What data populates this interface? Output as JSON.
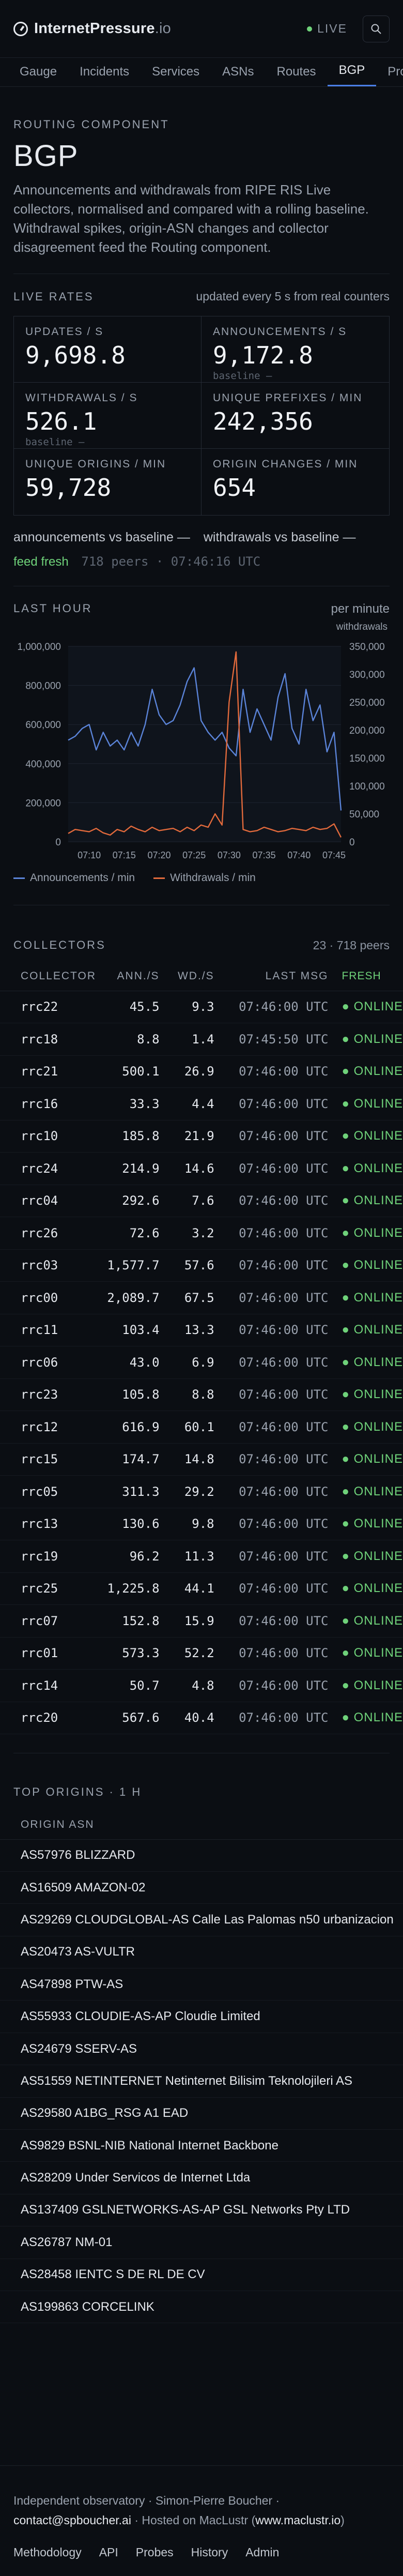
{
  "brand": {
    "name": "InternetPressure",
    "suffix": ".io"
  },
  "live": {
    "label": "LIVE"
  },
  "nav": {
    "tabs": [
      "Gauge",
      "Incidents",
      "Services",
      "ASNs",
      "Routes",
      "BGP",
      "Pro"
    ],
    "active": "BGP"
  },
  "hero": {
    "eyebrow": "ROUTING COMPONENT",
    "title": "BGP",
    "description": "Announcements and withdrawals from RIPE RIS Live collectors, normalised and compared with a rolling baseline. Withdrawal spikes, origin-ASN changes and collector disagreement feed the Routing component."
  },
  "rates": {
    "eyebrow": "LIVE RATES",
    "note": "updated every 5 s from real counters",
    "cells": [
      {
        "label": "UPDATES / S",
        "value": "9,698.8",
        "baseline": ""
      },
      {
        "label": "ANNOUNCEMENTS / S",
        "value": "9,172.8",
        "baseline": "baseline —"
      },
      {
        "label": "WITHDRAWALS / S",
        "value": "526.1",
        "baseline": "baseline —"
      },
      {
        "label": "UNIQUE PREFIXES / MIN",
        "value": "242,356",
        "baseline": ""
      },
      {
        "label": "UNIQUE ORIGINS / MIN",
        "value": "59,728",
        "baseline": ""
      },
      {
        "label": "ORIGIN CHANGES / MIN",
        "value": "654",
        "baseline": ""
      }
    ],
    "vs_announcements": "announcements vs baseline —",
    "vs_withdrawals": "withdrawals vs baseline —",
    "feed_status": "feed fresh",
    "feed_meta": "718 peers · 07:46:16 UTC"
  },
  "last_hour": {
    "eyebrow": "LAST HOUR",
    "unit": "per minute",
    "right_axis_label": "withdrawals",
    "legend_announcements": "Announcements / min",
    "legend_withdrawals": "Withdrawals / min"
  },
  "chart_data": {
    "type": "line",
    "x": [
      "07:07",
      "07:08",
      "07:09",
      "07:10",
      "07:11",
      "07:12",
      "07:13",
      "07:14",
      "07:15",
      "07:16",
      "07:17",
      "07:18",
      "07:19",
      "07:20",
      "07:21",
      "07:22",
      "07:23",
      "07:24",
      "07:25",
      "07:26",
      "07:27",
      "07:28",
      "07:29",
      "07:30",
      "07:31",
      "07:32",
      "07:33",
      "07:34",
      "07:35",
      "07:36",
      "07:37",
      "07:38",
      "07:39",
      "07:40",
      "07:41",
      "07:42",
      "07:43",
      "07:44",
      "07:45",
      "07:46"
    ],
    "xticks": [
      "07:10",
      "07:15",
      "07:20",
      "07:25",
      "07:30",
      "07:35",
      "07:40",
      "07:45"
    ],
    "left_ticks": [
      "1,000,000",
      "800,000",
      "600,000",
      "400,000",
      "200,000",
      "0"
    ],
    "right_ticks": [
      "350,000",
      "300,000",
      "250,000",
      "200,000",
      "150,000",
      "100,000",
      "50,000",
      "0"
    ],
    "ylim": [
      0,
      1000000
    ],
    "y2lim": [
      0,
      350000
    ],
    "series": [
      {
        "name": "Announcements / min",
        "axis": "left",
        "color": "#5b84d9",
        "values": [
          520000,
          540000,
          580000,
          600000,
          470000,
          560000,
          490000,
          520000,
          470000,
          560000,
          490000,
          600000,
          780000,
          650000,
          600000,
          620000,
          700000,
          820000,
          890000,
          620000,
          560000,
          520000,
          560000,
          480000,
          440000,
          780000,
          560000,
          680000,
          600000,
          520000,
          740000,
          860000,
          580000,
          500000,
          780000,
          620000,
          700000,
          460000,
          560000,
          160000
        ]
      },
      {
        "name": "Withdrawals / min",
        "axis": "right",
        "color": "#e26a3c",
        "values": [
          15000,
          22000,
          20000,
          18000,
          24000,
          16000,
          12000,
          22000,
          18000,
          28000,
          22000,
          18000,
          26000,
          20000,
          22000,
          24000,
          18000,
          26000,
          20000,
          30000,
          26000,
          50000,
          30000,
          250000,
          340000,
          22000,
          18000,
          20000,
          26000,
          22000,
          18000,
          20000,
          24000,
          22000,
          20000,
          26000,
          22000,
          24000,
          32000,
          8000
        ]
      }
    ]
  },
  "collectors": {
    "eyebrow": "COLLECTORS",
    "meta": "23 · 718 peers",
    "columns": [
      "COLLECTOR",
      "ANN./S",
      "WD./S",
      "LAST MSG",
      "FRESH"
    ],
    "rows": [
      [
        "rrc22",
        "45.5",
        "9.3",
        "07:46:00 UTC",
        "● ONLINE"
      ],
      [
        "rrc18",
        "8.8",
        "1.4",
        "07:45:50 UTC",
        "● ONLINE"
      ],
      [
        "rrc21",
        "500.1",
        "26.9",
        "07:46:00 UTC",
        "● ONLINE"
      ],
      [
        "rrc16",
        "33.3",
        "4.4",
        "07:46:00 UTC",
        "● ONLINE"
      ],
      [
        "rrc10",
        "185.8",
        "21.9",
        "07:46:00 UTC",
        "● ONLINE"
      ],
      [
        "rrc24",
        "214.9",
        "14.6",
        "07:46:00 UTC",
        "● ONLINE"
      ],
      [
        "rrc04",
        "292.6",
        "7.6",
        "07:46:00 UTC",
        "● ONLINE"
      ],
      [
        "rrc26",
        "72.6",
        "3.2",
        "07:46:00 UTC",
        "● ONLINE"
      ],
      [
        "rrc03",
        "1,577.7",
        "57.6",
        "07:46:00 UTC",
        "● ONLINE"
      ],
      [
        "rrc00",
        "2,089.7",
        "67.5",
        "07:46:00 UTC",
        "● ONLINE"
      ],
      [
        "rrc11",
        "103.4",
        "13.3",
        "07:46:00 UTC",
        "● ONLINE"
      ],
      [
        "rrc06",
        "43.0",
        "6.9",
        "07:46:00 UTC",
        "● ONLINE"
      ],
      [
        "rrc23",
        "105.8",
        "8.8",
        "07:46:00 UTC",
        "● ONLINE"
      ],
      [
        "rrc12",
        "616.9",
        "60.1",
        "07:46:00 UTC",
        "● ONLINE"
      ],
      [
        "rrc15",
        "174.7",
        "14.8",
        "07:46:00 UTC",
        "● ONLINE"
      ],
      [
        "rrc05",
        "311.3",
        "29.2",
        "07:46:00 UTC",
        "● ONLINE"
      ],
      [
        "rrc13",
        "130.6",
        "9.8",
        "07:46:00 UTC",
        "● ONLINE"
      ],
      [
        "rrc19",
        "96.2",
        "11.3",
        "07:46:00 UTC",
        "● ONLINE"
      ],
      [
        "rrc25",
        "1,225.8",
        "44.1",
        "07:46:00 UTC",
        "● ONLINE"
      ],
      [
        "rrc07",
        "152.8",
        "15.9",
        "07:46:00 UTC",
        "● ONLINE"
      ],
      [
        "rrc01",
        "573.3",
        "52.2",
        "07:46:00 UTC",
        "● ONLINE"
      ],
      [
        "rrc14",
        "50.7",
        "4.8",
        "07:46:00 UTC",
        "● ONLINE"
      ],
      [
        "rrc20",
        "567.6",
        "40.4",
        "07:46:00 UTC",
        "● ONLINE"
      ]
    ]
  },
  "top_origins": {
    "eyebrow": "TOP ORIGINS · 1 H",
    "column": "ORIGIN ASN",
    "rows": [
      "AS57976 BLIZZARD",
      "AS16509 AMAZON-02",
      "AS29269 CLOUDGLOBAL-AS Calle Las Palomas n50 urbanizacion",
      "AS20473 AS-VULTR",
      "AS47898 PTW-AS",
      "AS55933 CLOUDIE-AS-AP Cloudie Limited",
      "AS24679 SSERV-AS",
      "AS51559 NETINTERNET Netinternet Bilisim Teknolojileri AS",
      "AS29580 A1BG_RSG A1 EAD",
      "AS9829 BSNL-NIB National Internet Backbone",
      "AS28209 Under Servicos de Internet Ltda",
      "AS137409 GSLNETWORKS-AS-AP GSL Networks Pty LTD",
      "AS26787 NM-01",
      "AS28458 IENTC S DE RL DE CV",
      "AS199863 CORCELINK"
    ]
  },
  "footer": {
    "line1": "Independent observatory · Simon-Pierre Boucher ·",
    "email": "contact@spboucher.ai",
    "hosted": " · Hosted on MacLustr (",
    "host_link": "www.maclustr.io",
    "hosted_end": ")",
    "links": [
      "Methodology",
      "API",
      "Probes",
      "History",
      "Admin"
    ]
  },
  "colors": {
    "accent": "#4a7ee6",
    "online": "#6fd27a",
    "announcements": "#5b84d9",
    "withdrawals": "#e26a3c"
  }
}
